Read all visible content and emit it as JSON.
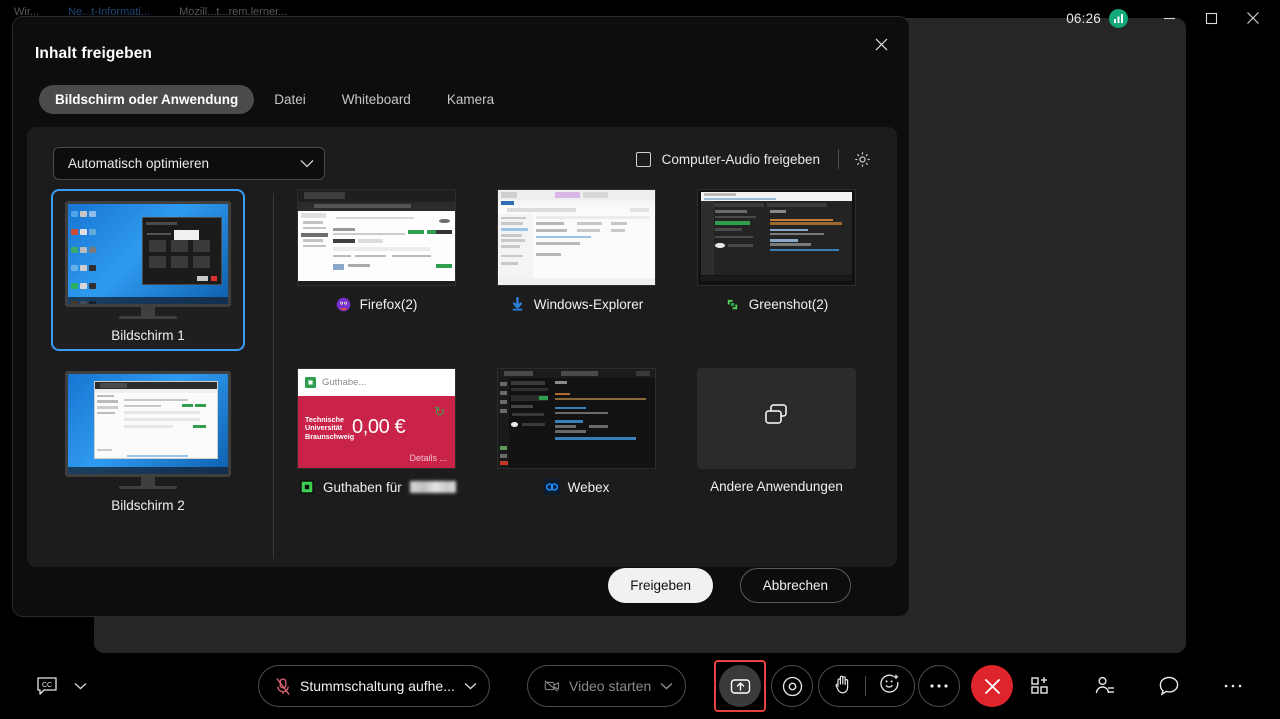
{
  "window": {
    "clock": "06:26",
    "network_icon": "signal-bars-icon",
    "minimize": "minimize-icon",
    "maximize": "maximize-icon",
    "close": "close-icon",
    "background_titles": [
      "Wir...",
      "Ne...t-Informati...",
      "Mozill...t...rem.lerner..."
    ]
  },
  "dialog": {
    "title": "Inhalt freigeben",
    "close_icon": "close-icon",
    "tabs": [
      {
        "label": "Bildschirm oder Anwendung",
        "active": true
      },
      {
        "label": "Datei",
        "active": false
      },
      {
        "label": "Whiteboard",
        "active": false
      },
      {
        "label": "Kamera",
        "active": false
      }
    ],
    "optimize_select": {
      "value": "Automatisch optimieren",
      "chevron": "chevron-down-icon"
    },
    "audio_checkbox": {
      "label": "Computer-Audio freigeben",
      "checked": false
    },
    "settings_icon": "gear-icon",
    "screens": [
      {
        "label": "Bildschirm 1",
        "selected": true
      },
      {
        "label": "Bildschirm 2",
        "selected": false
      }
    ],
    "apps": [
      {
        "label": "Firefox(2)",
        "icon": "firefox-icon",
        "kind": "firefox"
      },
      {
        "label": "Windows-Explorer",
        "icon": "download-arrow-icon",
        "kind": "explorer"
      },
      {
        "label": "Greenshot(2)",
        "icon": "greenshot-icon",
        "kind": "greenshot"
      },
      {
        "label": "Guthaben für ",
        "icon": "guthaben-icon",
        "kind": "guthaben",
        "redacted": true
      },
      {
        "label": "Webex",
        "icon": "webex-icon",
        "kind": "webex"
      },
      {
        "label": "Andere Anwendungen",
        "icon": "windows-stack-icon",
        "kind": "other"
      }
    ],
    "guthaben_card": {
      "header": "Guthabe...",
      "university": "Technische\nUniversität\nBraunschweig",
      "amount": "0,00 €",
      "details": "Details ..."
    },
    "buttons": {
      "share": "Freigeben",
      "cancel": "Abbrechen"
    }
  },
  "controlbar": {
    "cc_icon": "closed-caption-icon",
    "cc_chevron": "chevron-down-icon",
    "mute": {
      "label": "Stummschaltung aufhe...",
      "icon": "mic-muted-icon",
      "chevron": "chevron-down-icon"
    },
    "video": {
      "label": "Video starten",
      "icon": "camera-off-icon",
      "chevron": "chevron-down-icon"
    },
    "share": {
      "icon": "share-screen-icon",
      "highlighted": true
    },
    "record": {
      "icon": "record-icon"
    },
    "reactions": {
      "hand_icon": "raise-hand-icon",
      "emoji_icon": "emoji-reaction-icon"
    },
    "more": {
      "icon": "more-horizontal-icon"
    },
    "end": {
      "icon": "end-call-icon"
    },
    "right_icons": [
      "apps-add-icon",
      "participants-icon",
      "chat-bubble-icon",
      "more-options-icon"
    ]
  },
  "colors": {
    "accent": "#3b9cf5",
    "danger": "#e0242c",
    "highlight_border": "#e8403a",
    "dialog_bg": "#0d0d0d",
    "panel_bg": "#1c1c1c"
  }
}
